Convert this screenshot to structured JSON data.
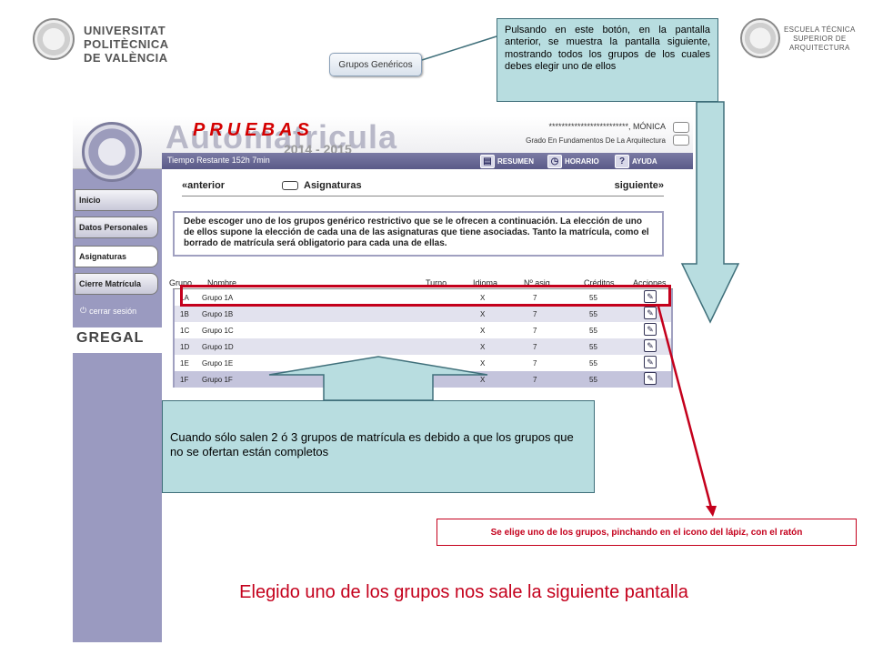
{
  "logos": {
    "upv": {
      "line1": "UNIVERSITAT",
      "line2": "POLITÈCNICA",
      "line3": "DE VALÈNCIA"
    },
    "etsa": {
      "line1": "ESCUELA TÉCNICA",
      "line2": "SUPERIOR DE",
      "line3": "ARQUITECTURA"
    }
  },
  "generic_button": {
    "label": "Grupos Genéricos"
  },
  "callouts": {
    "top": "Pulsando en este botón, en la pantalla anterior, se muestra la pantalla siguiente, mostrando todos los grupos de los cuales debes elegir uno de ellos",
    "middle": "Cuando sólo salen 2 ó 3 grupos de matrícula es debido a que los grupos que no se ofertan están completos",
    "pencil_note": "Se elige uno de los grupos, pinchando en el icono del lápiz, con el ratón"
  },
  "caption": "Elegido uno de los grupos nos sale la siguiente pantalla",
  "app": {
    "title": "Automatricula",
    "watermark": "PRUEBAS",
    "years": "2014 - 2015",
    "user": "*************************, MÓNICA",
    "degree": "Grado En Fundamentos De La Arquitectura",
    "time_remaining": "Tiempo Restante 152h 7min",
    "toolbar": {
      "resumen": "RESUMEN",
      "horario": "HORARIO",
      "ayuda": "AYUDA"
    },
    "nav": {
      "inicio": "Inicio",
      "datos": "Datos Personales",
      "asignaturas": "Asignaturas",
      "cierre": "Cierre Matrícula",
      "logout": "cerrar sesión",
      "gregal": "GREGAL"
    },
    "navbar": {
      "prev": "«anterior",
      "current": "Asignaturas",
      "next": "siguiente»"
    },
    "info": "Debe escoger uno de los grupos genérico restrictivo que se le ofrecen a continuación. La elección de uno de ellos supone la elección de cada una de las asignaturas que tiene asociadas. Tanto la matrícula, como el borrado de matrícula será obligatorio para cada una de ellas.",
    "table": {
      "headers": {
        "grupo": "Grupo",
        "nombre": "Nombre",
        "turno": "Turno",
        "idioma": "Idioma",
        "asig": "Nº asig.",
        "creditos": "Créditos",
        "acciones": "Acciones"
      },
      "rows": [
        {
          "grupo": "1A",
          "nombre": "Grupo 1A",
          "idioma": "X",
          "asig": "7",
          "creditos": "55"
        },
        {
          "grupo": "1B",
          "nombre": "Grupo 1B",
          "idioma": "X",
          "asig": "7",
          "creditos": "55"
        },
        {
          "grupo": "1C",
          "nombre": "Grupo 1C",
          "idioma": "X",
          "asig": "7",
          "creditos": "55"
        },
        {
          "grupo": "1D",
          "nombre": "Grupo 1D",
          "idioma": "X",
          "asig": "7",
          "creditos": "55"
        },
        {
          "grupo": "1E",
          "nombre": "Grupo 1E",
          "idioma": "X",
          "asig": "7",
          "creditos": "55"
        },
        {
          "grupo": "1F",
          "nombre": "Grupo 1F",
          "idioma": "X",
          "asig": "7",
          "creditos": "55"
        }
      ]
    }
  }
}
